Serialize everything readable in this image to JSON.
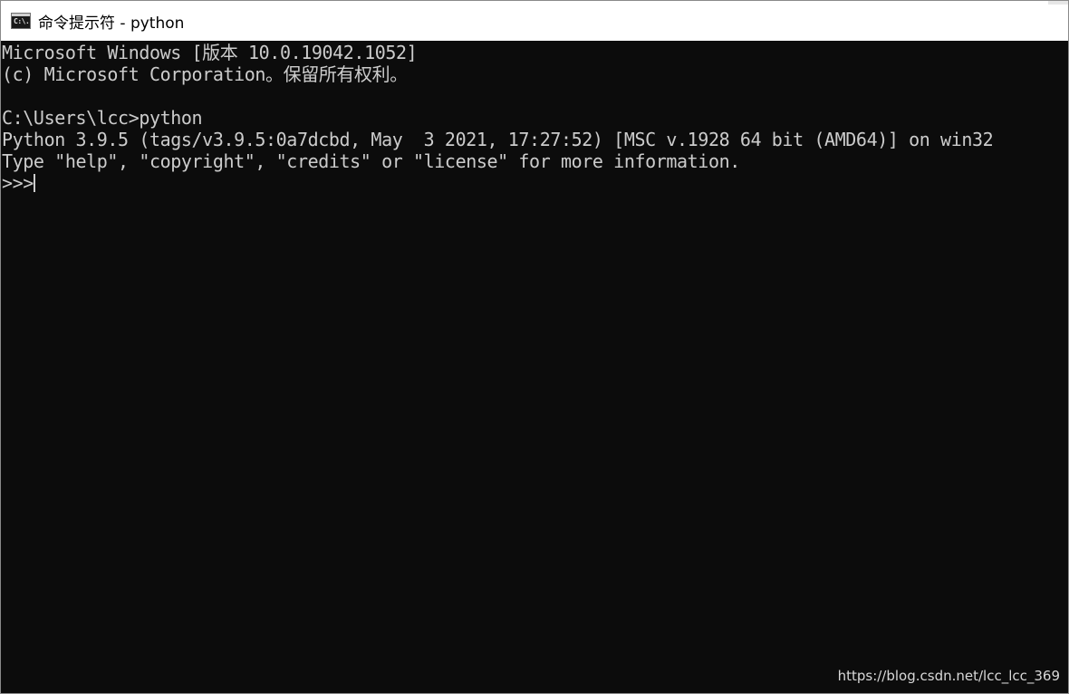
{
  "window": {
    "title": "命令提示符 - python",
    "icon": "cmd-icon",
    "icon_glyph": "C:\\."
  },
  "console": {
    "lines": [
      "Microsoft Windows [版本 10.0.19042.1052]",
      "(c) Microsoft Corporation。保留所有权利。",
      "",
      "C:\\Users\\lcc>python",
      "Python 3.9.5 (tags/v3.9.5:0a7dcbd, May  3 2021, 17:27:52) [MSC v.1928 64 bit (AMD64)] on win32",
      "Type \"help\", \"copyright\", \"credits\" or \"license\" for more information."
    ],
    "prompt": ">>>"
  },
  "watermark": "https://blog.csdn.net/lcc_lcc_369",
  "colors": {
    "console_bg": "#0c0c0c",
    "console_fg": "#cccccc",
    "titlebar_bg": "#ffffff"
  }
}
